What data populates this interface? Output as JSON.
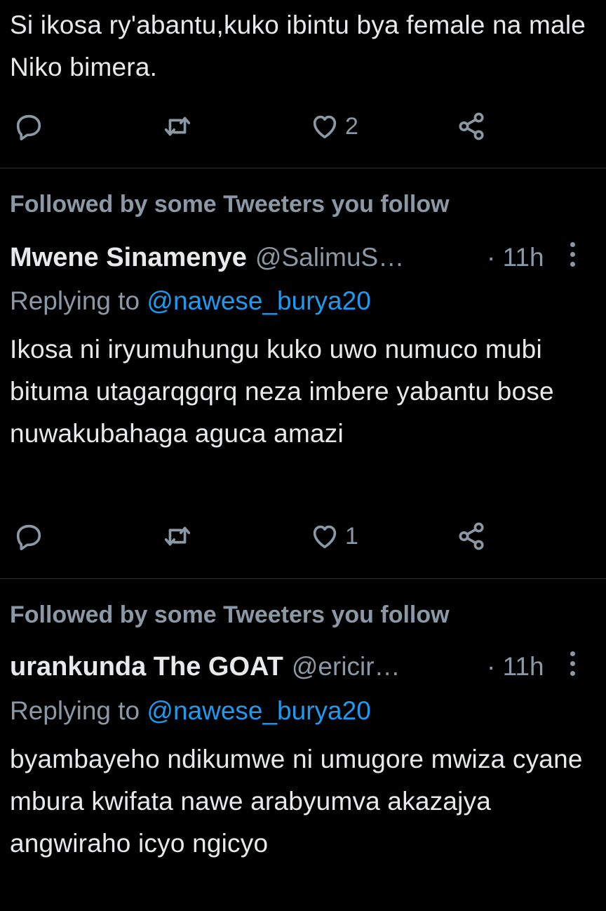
{
  "tweets": [
    {
      "text": "Si ikosa ry'abantu,kuko ibintu bya female na male Niko bimera.",
      "likes": "2"
    },
    {
      "social_context": "Followed by some Tweeters you follow",
      "display_name": "Mwene Sinamenye",
      "handle": "@SalimuS…",
      "time": "· 11h",
      "replying_prefix": "Replying to",
      "replying_to": "@nawese_burya20",
      "text": "Ikosa ni iryumuhungu kuko uwo numuco mubi bituma utagarqgqrq neza imbere yabantu bose nuwakubahaga aguca amazi",
      "likes": "1"
    },
    {
      "social_context": "Followed by some Tweeters you follow",
      "display_name": "urankunda The GOAT",
      "handle": "@ericir…",
      "time": "· 11h",
      "replying_prefix": "Replying to",
      "replying_to": "@nawese_burya20",
      "text": "byambayeho ndikumwe ni umugore mwiza cyane mbura kwifata nawe arabyumva akazajya angwiraho icyo ngicyo"
    }
  ],
  "icons": [
    "reply-icon",
    "retweet-icon",
    "like-icon",
    "share-icon",
    "more-icon"
  ],
  "colors": {
    "background": "#000000",
    "text": "#e7e9ea",
    "secondary": "#8b98a5",
    "link": "#1d9bf0",
    "divider": "#2f3336"
  }
}
